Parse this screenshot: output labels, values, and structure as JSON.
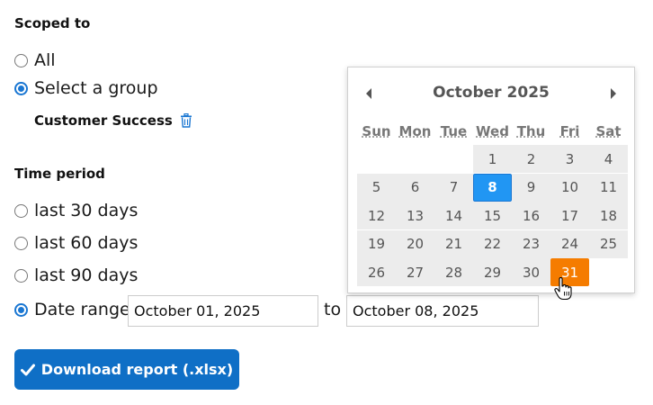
{
  "scope": {
    "title": "Scoped to",
    "options": [
      {
        "label": "All",
        "checked": false
      },
      {
        "label": "Select a group",
        "checked": true
      }
    ],
    "group": {
      "name": "Customer Success",
      "remove_icon": "trash-icon"
    }
  },
  "time_period": {
    "title": "Time period",
    "options": [
      {
        "label": "last 30 days",
        "checked": false
      },
      {
        "label": "last 60 days",
        "checked": false
      },
      {
        "label": "last 90 days",
        "checked": false
      },
      {
        "label": "Date range",
        "checked": true
      }
    ],
    "range": {
      "from": "October 01, 2025",
      "to_label": "to",
      "to": "October 08, 2025"
    }
  },
  "calendar": {
    "month": "October",
    "year": "2025",
    "weekdays": [
      "Sun",
      "Mon",
      "Tue",
      "Wed",
      "Thu",
      "Fri",
      "Sat"
    ],
    "first_day_column": 3,
    "days_in_month": 31,
    "selected_day": 8,
    "hovered_day": 31,
    "colors": {
      "selected": "#2196f3",
      "hovered": "#f57c00",
      "cell": "#ececec"
    }
  },
  "download": {
    "label": "Download report (.xlsx)",
    "icon": "check-icon",
    "color": "#0f6fc6"
  }
}
